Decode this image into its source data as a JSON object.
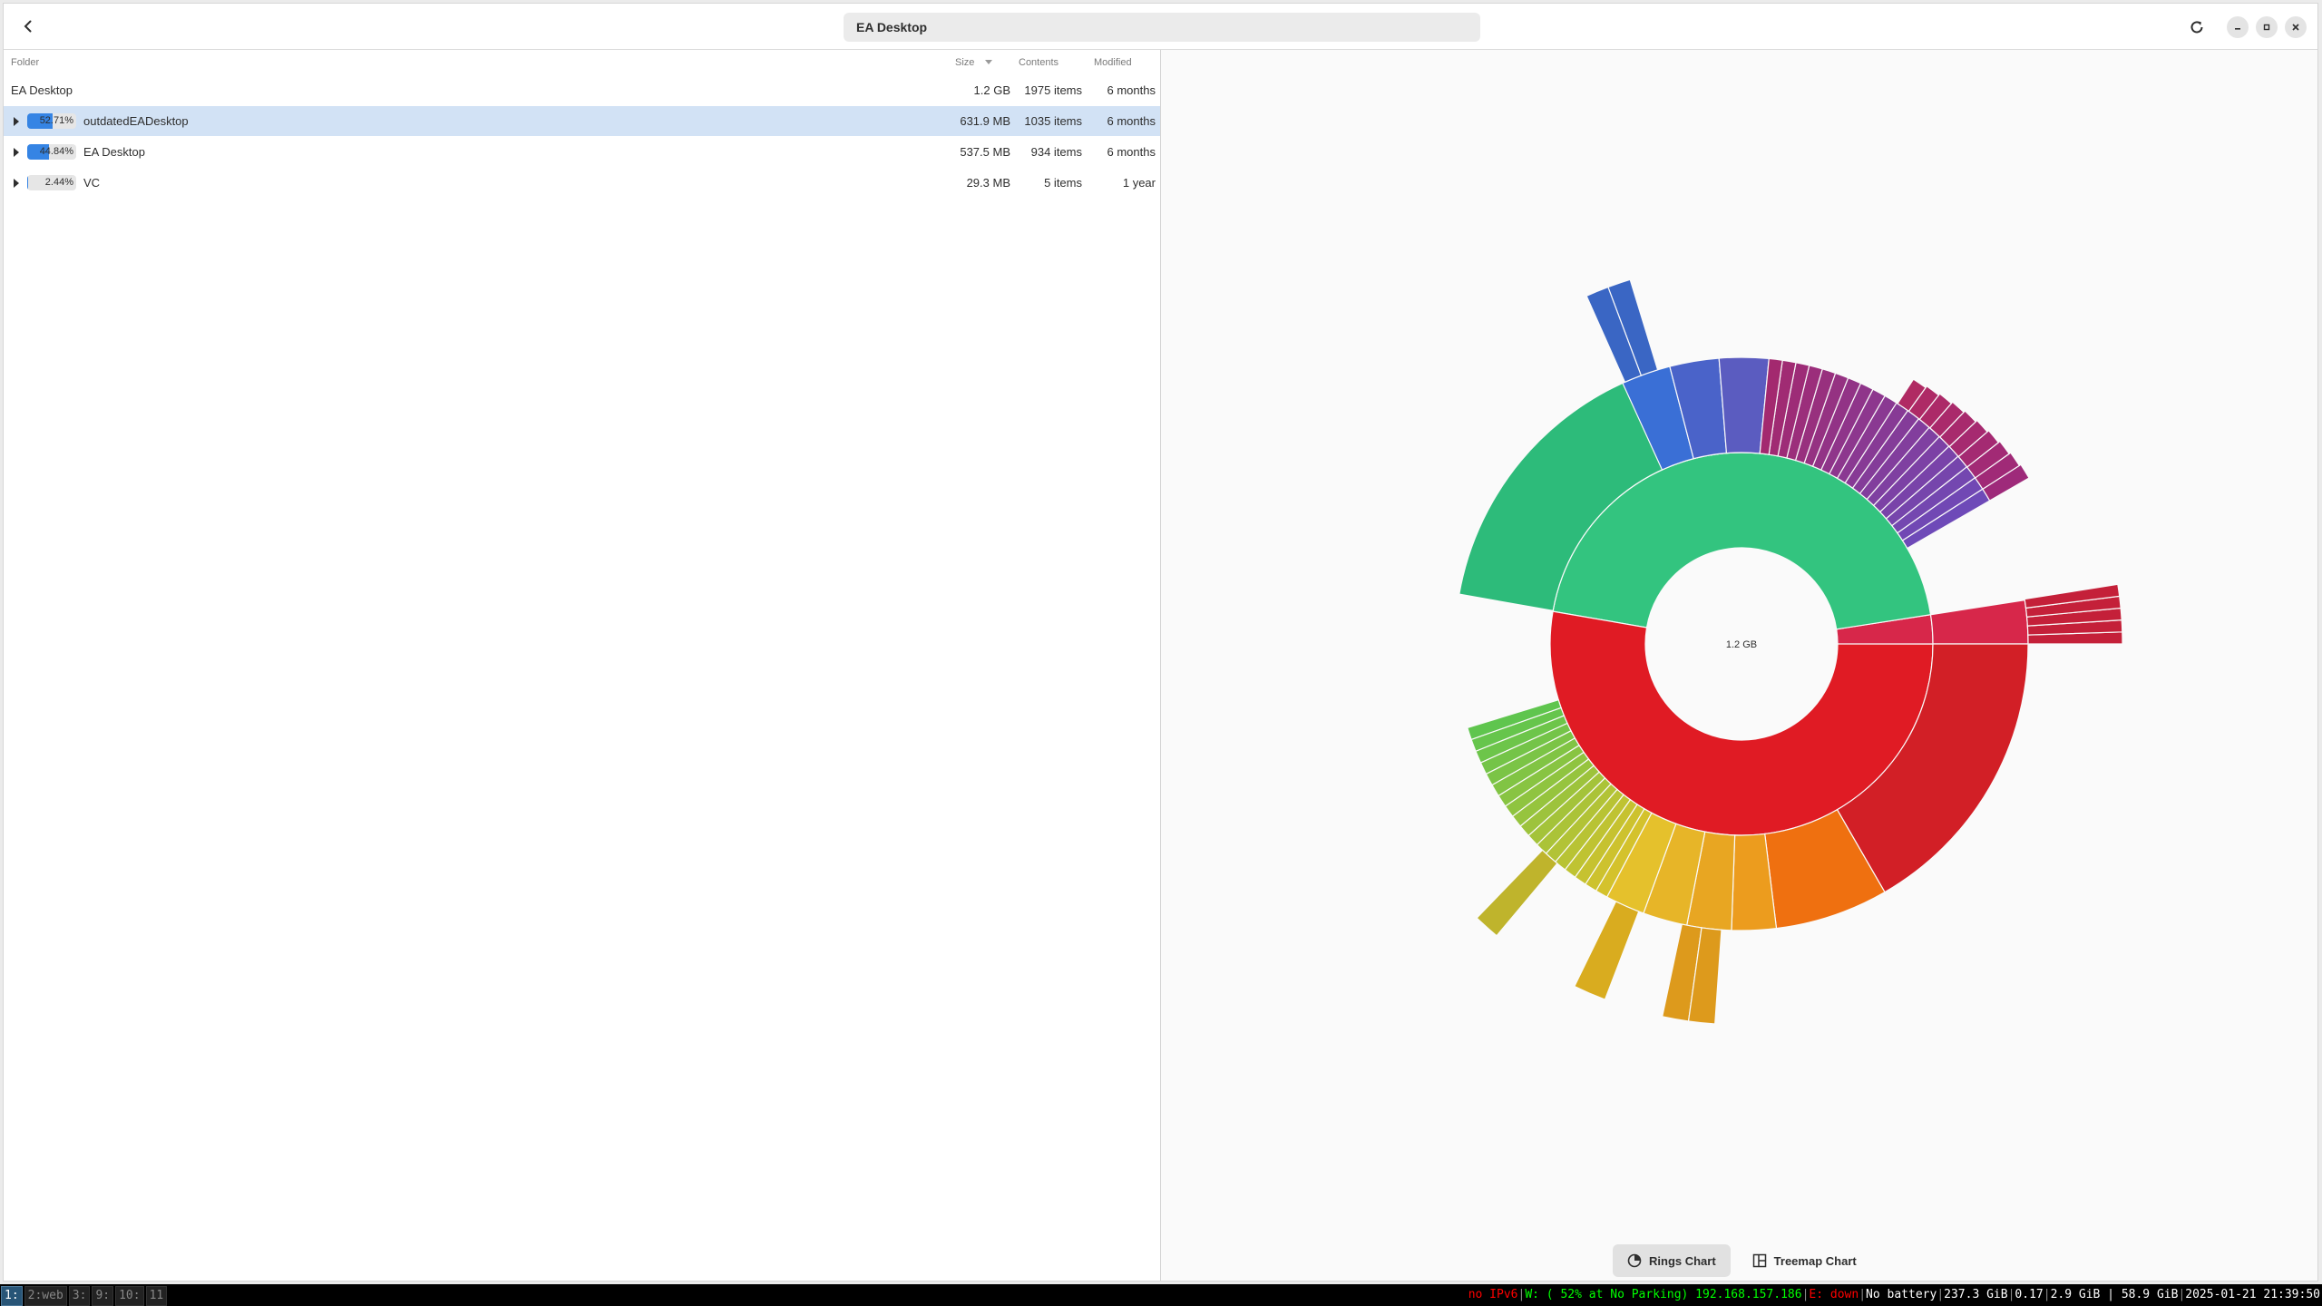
{
  "window": {
    "location": "EA Desktop"
  },
  "table": {
    "headers": {
      "folder": "Folder",
      "size": "Size",
      "contents": "Contents",
      "modified": "Modified"
    },
    "root": {
      "name": "EA Desktop",
      "size": "1.2 GB",
      "contents": "1975 items",
      "modified": "6 months"
    },
    "rows": [
      {
        "percent": "52.71%",
        "fraction": 0.5271,
        "name": "outdatedEADesktop",
        "size": "631.9 MB",
        "contents": "1035 items",
        "modified": "6 months"
      },
      {
        "percent": "44.84%",
        "fraction": 0.4484,
        "name": "EA Desktop",
        "size": "537.5 MB",
        "contents": "934 items",
        "modified": "6 months"
      },
      {
        "percent": "2.44%",
        "fraction": 0.0244,
        "name": "VC",
        "size": "29.3 MB",
        "contents": "5 items",
        "modified": "1 year"
      }
    ]
  },
  "chart": {
    "center_label": "1.2 GB",
    "rings_label": "Rings Chart",
    "treemap_label": "Treemap Chart"
  },
  "chart_data": {
    "type": "sunburst",
    "center": "1.2 GB",
    "ring1": [
      {
        "name": "outdatedEADesktop",
        "fraction": 0.5271,
        "color": "#e01b24"
      },
      {
        "name": "EA Desktop",
        "fraction": 0.4484,
        "color": "#33c47f"
      },
      {
        "name": "VC",
        "fraction": 0.0244,
        "color": "#d7274a"
      }
    ]
  },
  "statusbar": {
    "workspaces": [
      {
        "label": "1:",
        "active": true
      },
      {
        "label": "2:web",
        "active": false
      },
      {
        "label": "3:",
        "active": false
      },
      {
        "label": "9:",
        "active": false
      },
      {
        "label": "10:",
        "active": false
      },
      {
        "label": "11",
        "active": false
      }
    ],
    "ipv6": "no IPv6",
    "wifi": "W: ( 52% at No Parking) 192.168.157.186",
    "ethernet": "E: down",
    "battery": "No battery",
    "disk": "237.3 GiB",
    "load": "0.17",
    "memory": "2.9 GiB | 58.9 GiB",
    "datetime": "2025-01-21 21:39:50",
    "colors": {
      "good": "#00ff00",
      "bad": "#ff0000",
      "neutral": "#ffffff"
    }
  }
}
